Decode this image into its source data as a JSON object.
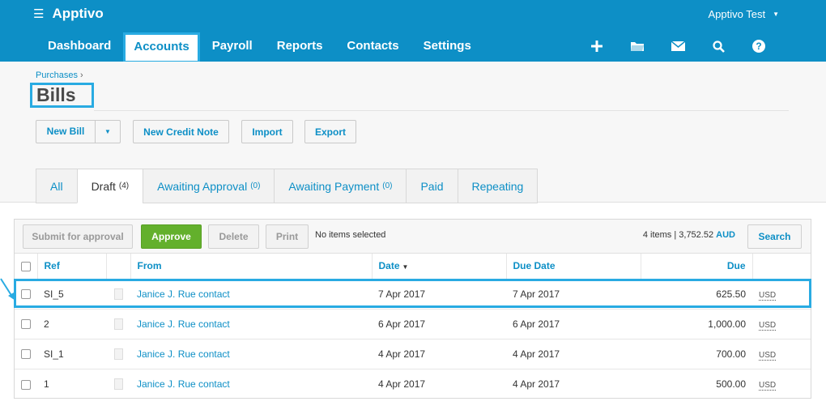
{
  "app": {
    "name": "Apptivo",
    "account": "Apptivo Test"
  },
  "nav": [
    {
      "label": "Dashboard"
    },
    {
      "label": "Accounts"
    },
    {
      "label": "Payroll"
    },
    {
      "label": "Reports"
    },
    {
      "label": "Contacts"
    },
    {
      "label": "Settings"
    }
  ],
  "header_icons": [
    "plus-icon",
    "folder-icon",
    "mail-icon",
    "search-icon",
    "help-icon"
  ],
  "breadcrumb": {
    "parent": "Purchases",
    "separator": "›"
  },
  "page": {
    "title": "Bills"
  },
  "buttons": {
    "new_bill": "New Bill",
    "new_credit_note": "New Credit Note",
    "import": "Import",
    "export": "Export"
  },
  "tabs": [
    {
      "label": "All",
      "count": ""
    },
    {
      "label": "Draft",
      "count": "(4)"
    },
    {
      "label": "Awaiting Approval",
      "count": "(0)"
    },
    {
      "label": "Awaiting Payment",
      "count": "(0)"
    },
    {
      "label": "Paid",
      "count": ""
    },
    {
      "label": "Repeating",
      "count": ""
    }
  ],
  "toolbar": {
    "submit": "Submit for approval",
    "approve": "Approve",
    "delete": "Delete",
    "print": "Print",
    "selection": "No items selected",
    "totals_text": "4 items | 3,752.52",
    "totals_currency": "AUD",
    "search": "Search"
  },
  "table": {
    "headers": {
      "ref": "Ref",
      "from": "From",
      "date": "Date",
      "due_date": "Due Date",
      "due": "Due"
    },
    "rows": [
      {
        "ref": "SI_5",
        "from": "Janice J. Rue contact",
        "date": "7 Apr 2017",
        "due_date": "7 Apr 2017",
        "due": "625.50",
        "currency": "USD"
      },
      {
        "ref": "2",
        "from": "Janice J. Rue contact",
        "date": "6 Apr 2017",
        "due_date": "6 Apr 2017",
        "due": "1,000.00",
        "currency": "USD"
      },
      {
        "ref": "SI_1",
        "from": "Janice J. Rue contact",
        "date": "4 Apr 2017",
        "due_date": "4 Apr 2017",
        "due": "700.00",
        "currency": "USD"
      },
      {
        "ref": "1",
        "from": "Janice J. Rue contact",
        "date": "4 Apr 2017",
        "due_date": "4 Apr 2017",
        "due": "500.00",
        "currency": "USD"
      }
    ]
  },
  "colors": {
    "brand": "#0d8fc6",
    "highlight": "#29abe2",
    "approve": "#63b02c"
  }
}
